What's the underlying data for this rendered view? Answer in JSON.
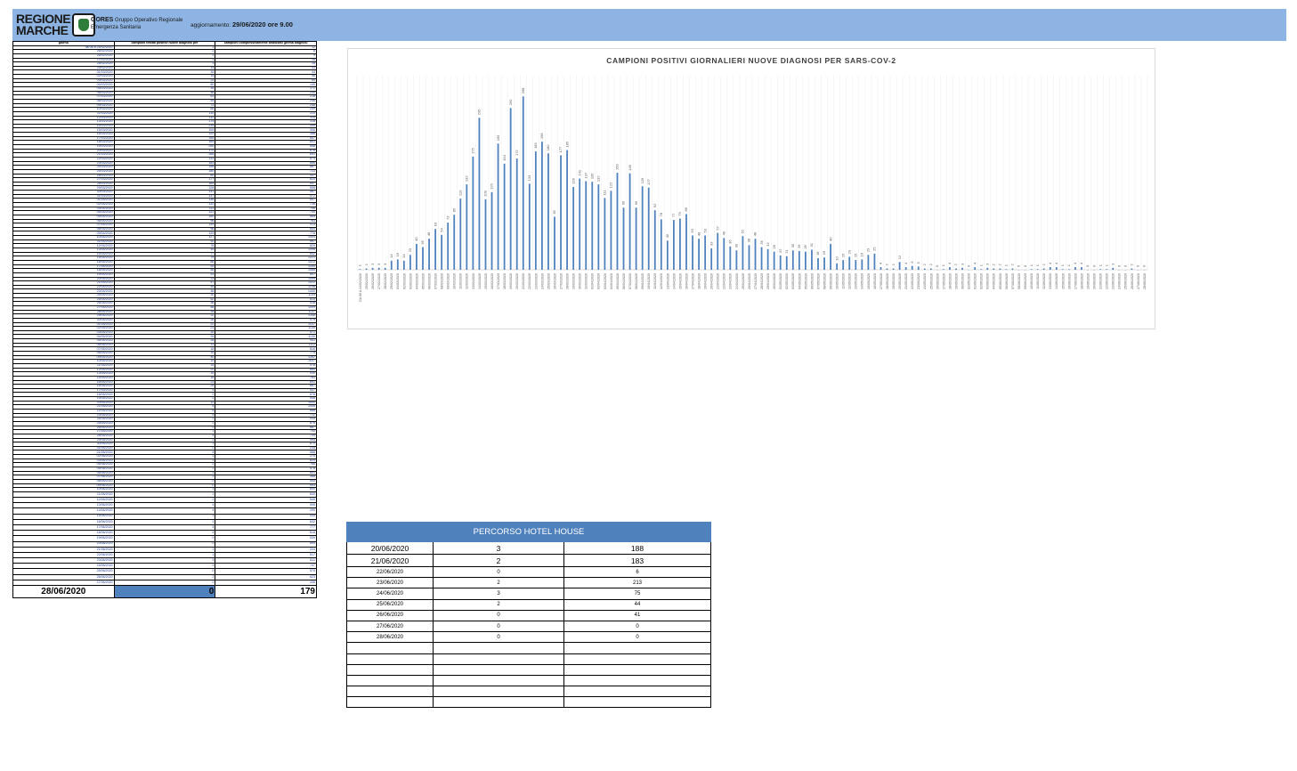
{
  "header": {
    "logo_line1": "REGIONE",
    "logo_line2": "MARCHE",
    "gores_title": "GORES",
    "gores_subtitle": "Gruppo Operativo Regionale",
    "gores_subtitle2": "Emergenza Sanitaria",
    "update_label": "aggiornamento:",
    "update_value": "29/06/2020 ore 9.00",
    "band_color": "#8eb4e3"
  },
  "left_table": {
    "headers": [
      "giorno",
      "campioni testati positivi nuove diagnosi per",
      "campioni complessivamente analizzati (prima diagnosi"
    ],
    "rows": [
      [
        "da 06 a 24/02/2020",
        "1",
        "12"
      ],
      [
        "26/02/2020",
        "2",
        "8"
      ],
      [
        "26/02/2020",
        "3",
        "9"
      ],
      [
        "27/02/2020",
        "3",
        "18"
      ],
      [
        "28/02/2020",
        "3",
        "28"
      ],
      [
        "29/02/2020",
        "14",
        "33"
      ],
      [
        "01/03/2020",
        "16",
        "44"
      ],
      [
        "02/03/2020",
        "14",
        "48"
      ],
      [
        "03/03/2020",
        "23",
        "69"
      ],
      [
        "04/03/2020",
        "80",
        "140"
      ],
      [
        "05/03/2020",
        "35",
        "172"
      ],
      [
        "06/03/2020",
        "48",
        "230"
      ],
      [
        "07/03/2020",
        "63",
        "218"
      ],
      [
        "08/03/2020",
        "54",
        "246"
      ],
      [
        "09/03/2020",
        "73",
        "256"
      ],
      [
        "10/03/2020",
        "85",
        "249"
      ],
      [
        "11/03/2020",
        "110",
        "310"
      ],
      [
        "12/03/2020",
        "132",
        "315"
      ],
      [
        "13/03/2020",
        "175",
        "318"
      ],
      [
        "14/03/2020",
        "235",
        "399"
      ],
      [
        "15/03/2020",
        "109",
        "306"
      ],
      [
        "16/03/2020",
        "120",
        "386"
      ],
      [
        "17/03/2020",
        "195",
        "547"
      ],
      [
        "18/03/2020",
        "164",
        "601"
      ],
      [
        "19/03/2020",
        "250",
        "658"
      ],
      [
        "20/03/2020",
        "172",
        "676"
      ],
      [
        "21/03/2020",
        "268",
        "651"
      ],
      [
        "22/03/2020",
        "133",
        "674"
      ],
      [
        "23/03/2020",
        "183",
        "666"
      ],
      [
        "24/03/2020",
        "198",
        "667"
      ],
      [
        "25/03/2020",
        "180",
        "722"
      ],
      [
        "26/03/2020",
        "82",
        "437"
      ],
      [
        "27/03/2020",
        "177",
        "620"
      ],
      [
        "28/03/2020",
        "185",
        "547"
      ],
      [
        "29/03/2020",
        "128",
        "558"
      ],
      [
        "30/03/2020",
        "141",
        "567"
      ],
      [
        "31/03/2020",
        "137",
        "572"
      ],
      [
        "01/04/2020",
        "136",
        "647"
      ],
      [
        "02/04/2020",
        "132",
        "736"
      ],
      [
        "03/04/2020",
        "111",
        "706"
      ],
      [
        "04/04/2020",
        "122",
        "740"
      ],
      [
        "05/04/2020",
        "150",
        "865"
      ],
      [
        "06/04/2020",
        "96",
        "763"
      ],
      [
        "07/04/2020",
        "149",
        "913"
      ],
      [
        "08/04/2020",
        "96",
        "804"
      ],
      [
        "09/04/2020",
        "129",
        "776"
      ],
      [
        "10/04/2020",
        "127",
        "1004"
      ],
      [
        "11/04/2020",
        "92",
        "997"
      ],
      [
        "12/04/2020",
        "78",
        "829"
      ],
      [
        "13/04/2020",
        "45",
        "1098"
      ],
      [
        "14/04/2020",
        "77",
        "842"
      ],
      [
        "15/04/2020",
        "79",
        "1221"
      ],
      [
        "16/04/2020",
        "86",
        "1012"
      ],
      [
        "17/04/2020",
        "53",
        "1250"
      ],
      [
        "18/04/2020",
        "48",
        "1086"
      ],
      [
        "19/04/2020",
        "53",
        "807"
      ],
      [
        "20/04/2020",
        "33",
        "1099"
      ],
      [
        "21/04/2020",
        "57",
        "1412"
      ],
      [
        "22/04/2020",
        "49",
        "1238"
      ],
      [
        "23/04/2020",
        "36",
        "1440"
      ],
      [
        "24/04/2020",
        "30",
        "1133"
      ],
      [
        "25/04/2020",
        "52",
        "814"
      ],
      [
        "26/04/2020",
        "38",
        "518"
      ],
      [
        "27/04/2020",
        "48",
        "1099"
      ],
      [
        "28/04/2020",
        "35",
        "1137"
      ],
      [
        "29/04/2020",
        "32",
        "1348"
      ],
      [
        "30/04/2020",
        "28",
        "979"
      ],
      [
        "01/05/2020",
        "22",
        "1037"
      ],
      [
        "02/05/2020",
        "21",
        "1135"
      ],
      [
        "03/05/2020",
        "30",
        "571"
      ],
      [
        "04/05/2020",
        "29",
        "1130"
      ],
      [
        "05/05/2020",
        "28",
        "941"
      ],
      [
        "06/05/2020",
        "31",
        "1112"
      ],
      [
        "07/05/2020",
        "18",
        "816"
      ],
      [
        "08/05/2020",
        "19",
        "775"
      ],
      [
        "09/05/2020",
        "40",
        "1262"
      ],
      [
        "10/05/2020",
        "10",
        "1037"
      ],
      [
        "11/05/2020",
        "15",
        "578"
      ],
      [
        "12/05/2020",
        "20",
        "860"
      ],
      [
        "13/05/2020",
        "15",
        "930"
      ],
      [
        "14/05/2020",
        "16",
        "783"
      ],
      [
        "15/05/2020",
        "23",
        "691"
      ],
      [
        "16/05/2020",
        "25",
        "867"
      ],
      [
        "17/05/2020",
        "4",
        "537"
      ],
      [
        "18/05/2020",
        "2",
        "676"
      ],
      [
        "19/05/2020",
        "2",
        "946"
      ],
      [
        "20/05/2020",
        "12",
        "1000"
      ],
      [
        "21/05/2020",
        "4",
        "1006"
      ],
      [
        "22/05/2020",
        "6",
        "688"
      ],
      [
        "23/05/2020",
        "5",
        "712"
      ],
      [
        "24/05/2020",
        "2",
        "435"
      ],
      [
        "25/05/2020",
        "2",
        "676"
      ],
      [
        "26/05/2020",
        "0",
        "857"
      ],
      [
        "27/05/2020",
        "1",
        "790"
      ],
      [
        "28/05/2020",
        "4",
        "734"
      ],
      [
        "29/05/2020",
        "2",
        "595"
      ],
      [
        "30/05/2020",
        "3",
        "670"
      ],
      [
        "31/05/2020",
        "0",
        "235"
      ],
      [
        "01/06/2020",
        "4",
        "586"
      ],
      [
        "02/06/2020",
        "1",
        "275"
      ],
      [
        "03/06/2020",
        "3",
        "624"
      ],
      [
        "04/06/2020",
        "2",
        "768"
      ],
      [
        "05/06/2020",
        "2",
        "578"
      ],
      [
        "06/06/2020",
        "1",
        "601"
      ],
      [
        "07/06/2020",
        "2",
        "366"
      ],
      [
        "08/06/2020",
        "0",
        "595"
      ],
      [
        "09/06/2020",
        "0",
        "593"
      ],
      [
        "10/06/2020",
        "1",
        "600"
      ],
      [
        "11/06/2020",
        "1",
        "609"
      ],
      [
        "12/06/2020",
        "2",
        "549"
      ],
      [
        "13/06/2020",
        "4",
        "595"
      ],
      [
        "14/06/2020",
        "4",
        "290"
      ],
      [
        "15/06/2020",
        "1",
        "535"
      ],
      [
        "16/06/2020",
        "1",
        "632"
      ],
      [
        "17/06/2020",
        "4",
        "777"
      ],
      [
        "18/06/2020",
        "4",
        "616"
      ],
      [
        "19/06/2020",
        "0",
        "539"
      ],
      [
        "20/06/2020",
        "0",
        "695"
      ],
      [
        "21/06/2020",
        "1",
        "224"
      ],
      [
        "22/06/2020",
        "1",
        "517"
      ],
      [
        "23/06/2020",
        "3",
        "611"
      ],
      [
        "24/06/2020",
        "0",
        "747"
      ],
      [
        "25/06/2020",
        "0",
        "570"
      ],
      [
        "26/06/2020",
        "2",
        "623"
      ],
      [
        "27/06/2020",
        "0",
        "436"
      ]
    ],
    "final": {
      "date": "28/06/2020",
      "value": "0",
      "total": "179"
    }
  },
  "chart_data": {
    "type": "bar",
    "title": "CAMPIONI POSITIVI GIORNALIERI NUOVE DIAGNOSI PER SARS-COV-2",
    "color": "#4f81bd",
    "categories": [
      "DA 06 A 24/02/2020",
      "25/02/2020",
      "26/02/2020",
      "27/02/2020",
      "28/02/2020",
      "29/02/2020",
      "01/03/2020",
      "02/03/2020",
      "03/03/2020",
      "04/03/2020",
      "05/03/2020",
      "06/03/2020",
      "07/03/2020",
      "08/03/2020",
      "09/03/2020",
      "10/03/2020",
      "11/03/2020",
      "12/03/2020",
      "13/03/2020",
      "14/03/2020",
      "15/03/2020",
      "16/03/2020",
      "17/03/2020",
      "18/03/2020",
      "19/03/2020",
      "20/03/2020",
      "21/03/2020",
      "22/03/2020",
      "23/03/2020",
      "24/03/2020",
      "25/03/2020",
      "26/03/2020",
      "27/03/2020",
      "28/03/2020",
      "29/03/2020",
      "30/03/2020",
      "31/03/2020",
      "01/04/2020",
      "02/04/2020",
      "03/04/2020",
      "04/04/2020",
      "05/04/2020",
      "06/04/2020",
      "07/04/2020",
      "08/04/2020",
      "09/04/2020",
      "10/04/2020",
      "11/04/2020",
      "12/04/2020",
      "13/04/2020",
      "14/04/2020",
      "15/04/2020",
      "16/04/2020",
      "17/04/2020",
      "18/04/2020",
      "19/04/2020",
      "20/04/2020",
      "21/04/2020",
      "22/04/2020",
      "23/04/2020",
      "24/04/2020",
      "25/04/2020",
      "26/04/2020",
      "27/04/2020",
      "28/04/2020",
      "29/04/2020",
      "30/04/2020",
      "01/05/2020",
      "02/05/2020",
      "03/05/2020",
      "04/05/2020",
      "05/05/2020",
      "06/05/2020",
      "07/05/2020",
      "08/05/2020",
      "09/05/2020",
      "10/05/2020",
      "11/05/2020",
      "12/05/2020",
      "13/05/2020",
      "14/05/2020",
      "15/05/2020",
      "16/05/2020",
      "17/05/2020",
      "18/05/2020",
      "19/05/2020",
      "20/05/2020",
      "21/05/2020",
      "22/05/2020",
      "23/05/2020",
      "24/05/2020",
      "25/05/2020",
      "26/05/2020",
      "27/05/2020",
      "28/05/2020",
      "29/05/2020",
      "30/05/2020",
      "31/05/2020",
      "01/06/2020",
      "02/06/2020",
      "03/06/2020",
      "04/06/2020",
      "05/06/2020",
      "06/06/2020",
      "07/06/2020",
      "08/06/2020",
      "09/06/2020",
      "10/06/2020",
      "11/06/2020",
      "12/06/2020",
      "13/06/2020",
      "14/06/2020",
      "15/06/2020",
      "16/06/2020",
      "17/06/2020",
      "18/06/2020",
      "19/06/2020",
      "20/06/2020",
      "21/06/2020",
      "22/06/2020",
      "23/06/2020",
      "24/06/2020",
      "25/06/2020",
      "26/06/2020",
      "27/06/2020",
      "28/06/2020"
    ],
    "values": [
      1,
      2,
      3,
      3,
      3,
      14,
      16,
      14,
      23,
      40,
      35,
      48,
      63,
      54,
      73,
      85,
      110,
      132,
      175,
      235,
      109,
      120,
      195,
      164,
      250,
      172,
      268,
      133,
      183,
      198,
      180,
      82,
      177,
      185,
      128,
      141,
      137,
      136,
      132,
      111,
      122,
      150,
      96,
      149,
      96,
      129,
      127,
      92,
      78,
      45,
      77,
      79,
      86,
      53,
      48,
      53,
      33,
      57,
      49,
      36,
      30,
      52,
      38,
      48,
      35,
      32,
      28,
      22,
      21,
      30,
      29,
      28,
      31,
      18,
      19,
      40,
      10,
      15,
      20,
      15,
      16,
      23,
      25,
      4,
      2,
      2,
      12,
      4,
      6,
      5,
      2,
      2,
      0,
      1,
      4,
      2,
      3,
      0,
      4,
      1,
      3,
      2,
      2,
      1,
      2,
      0,
      0,
      1,
      1,
      2,
      4,
      4,
      1,
      1,
      4,
      4,
      0,
      0,
      1,
      1,
      3,
      0,
      0,
      2,
      0,
      0
    ],
    "ylim": [
      0,
      300
    ],
    "grid": "vertical"
  },
  "hotel": {
    "title": "PERCORSO HOTEL HOUSE",
    "rows": [
      [
        "20/06/2020",
        "3",
        "188"
      ],
      [
        "21/06/2020",
        "2",
        "183"
      ],
      [
        "22/06/2020",
        "0",
        "6"
      ],
      [
        "23/06/2020",
        "2",
        "213"
      ],
      [
        "24/06/2020",
        "3",
        "75"
      ],
      [
        "25/06/2020",
        "2",
        "44"
      ],
      [
        "26/06/2020",
        "0",
        "41"
      ],
      [
        "27/06/2020",
        "0",
        "0"
      ],
      [
        "28/06/2020",
        "0",
        "0"
      ]
    ],
    "empty_rows": 6,
    "color": "#4f81bd"
  }
}
